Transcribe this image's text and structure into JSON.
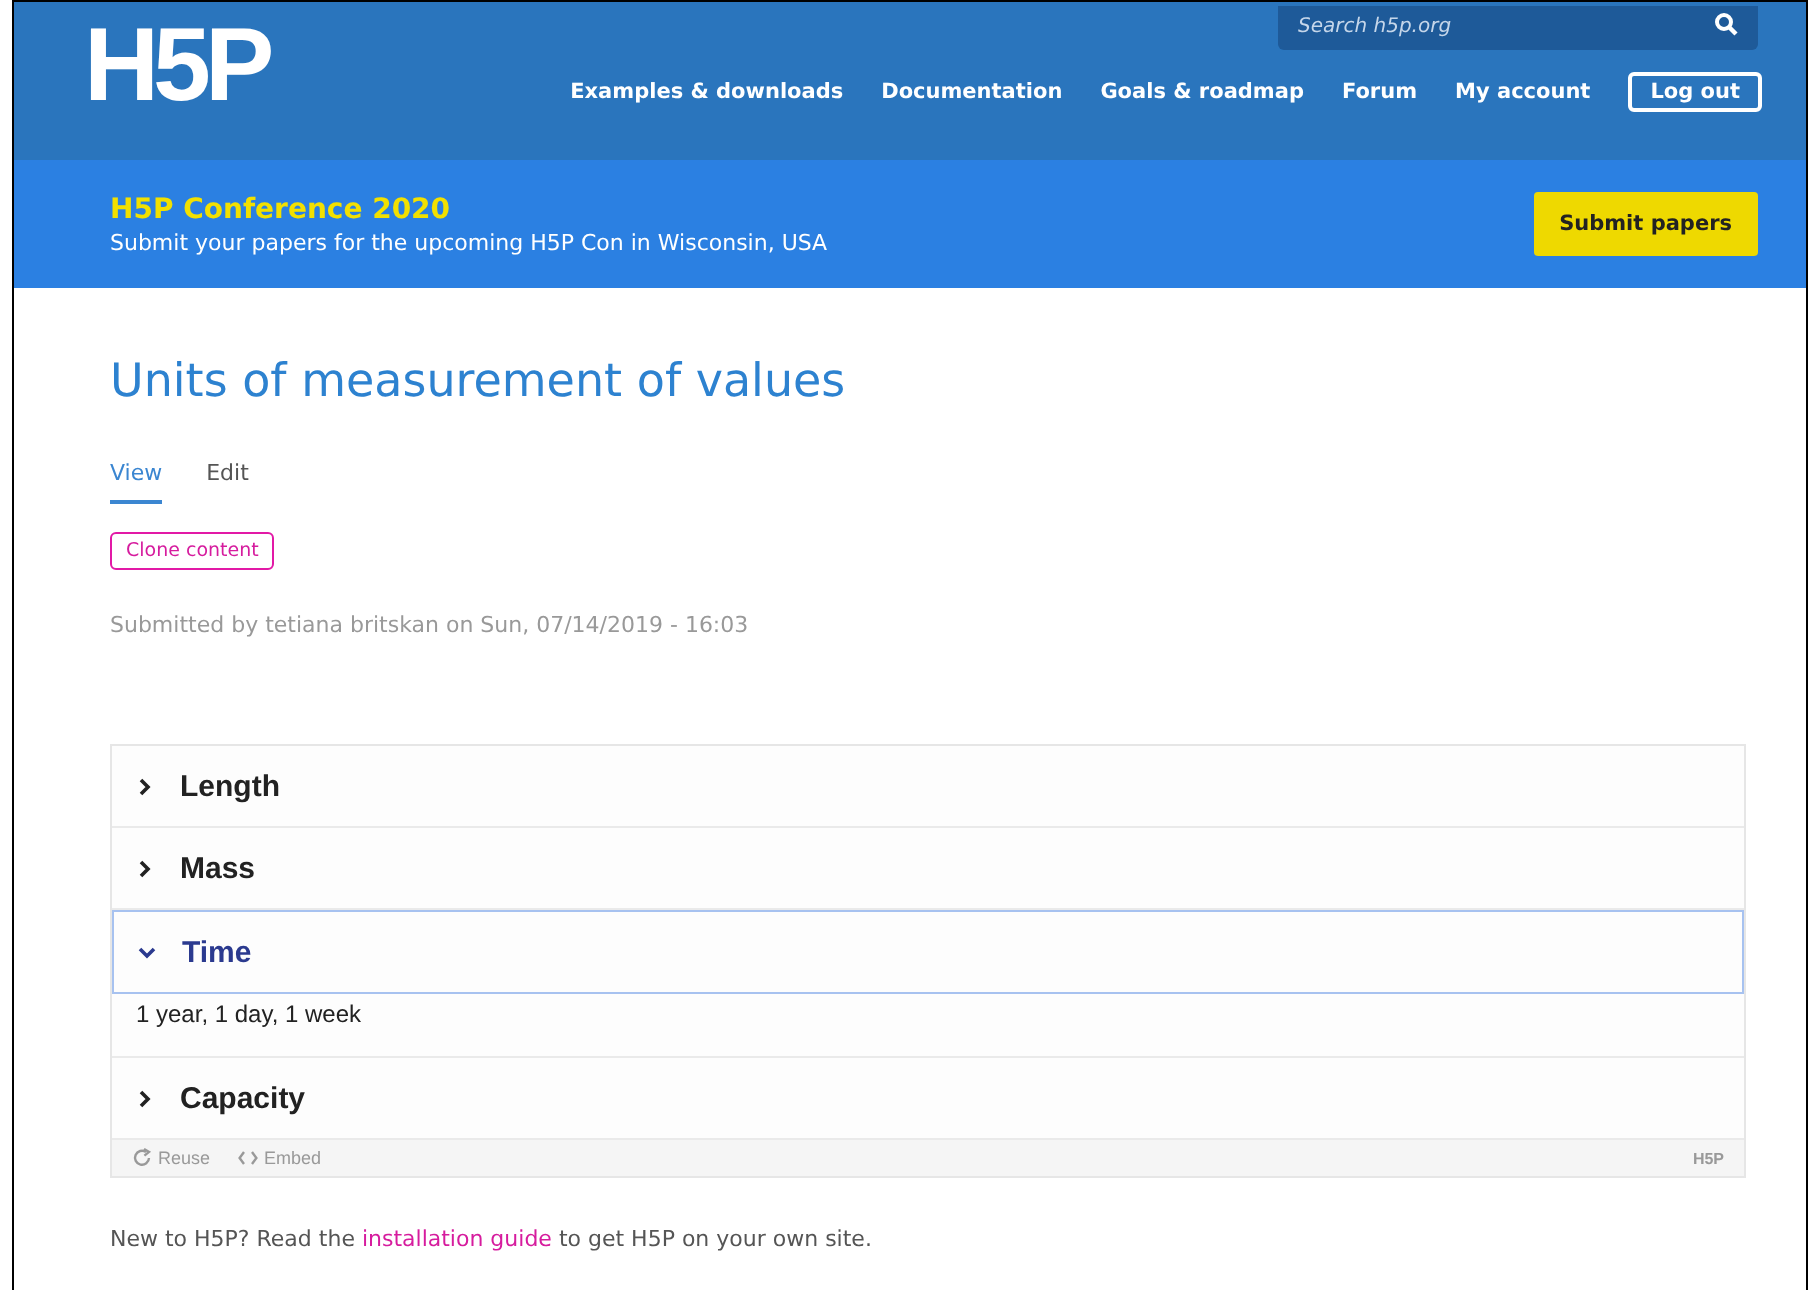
{
  "header": {
    "logo": "H5P",
    "search": {
      "placeholder": "Search h5p.org"
    },
    "nav": [
      {
        "label": "Examples & downloads",
        "kind": "link"
      },
      {
        "label": "Documentation",
        "kind": "link"
      },
      {
        "label": "Goals & roadmap",
        "kind": "link"
      },
      {
        "label": "Forum",
        "kind": "link"
      },
      {
        "label": "My account",
        "kind": "link"
      },
      {
        "label": "Log out",
        "kind": "button"
      }
    ]
  },
  "banner": {
    "title": "H5P Conference 2020",
    "text": "Submit your papers for the upcoming H5P Con in Wisconsin, USA",
    "button": "Submit papers"
  },
  "page": {
    "title": "Units of measurement of values",
    "tabs": [
      {
        "label": "View",
        "selected": true
      },
      {
        "label": "Edit",
        "selected": false
      }
    ],
    "clone_button": "Clone content",
    "submitted": "Submitted by tetiana britskan on Sun, 07/14/2019 - 16:03"
  },
  "accordion": {
    "items": [
      {
        "title": "Length",
        "expanded": false
      },
      {
        "title": "Mass",
        "expanded": false
      },
      {
        "title": "Time",
        "expanded": true,
        "content": "1 year, 1 day, 1 week"
      },
      {
        "title": "Capacity",
        "expanded": false
      }
    ],
    "footer": {
      "reuse": "Reuse",
      "embed": "Embed",
      "logo": "H5P"
    }
  },
  "note": {
    "before": "New to H5P? Read the ",
    "link": "installation guide",
    "after": " to get H5P on your own site."
  }
}
